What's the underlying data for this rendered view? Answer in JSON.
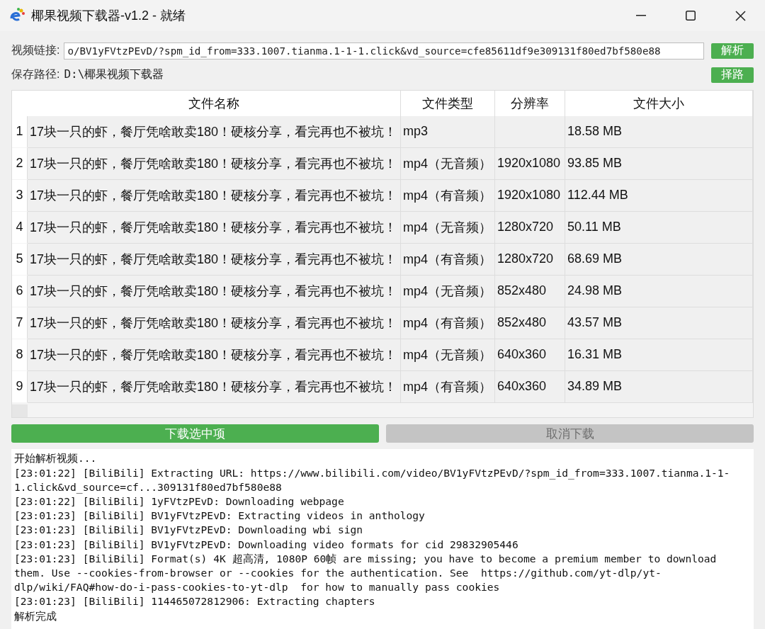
{
  "window": {
    "title": "椰果视频下载器-v1.2 - 就绪"
  },
  "url_field": {
    "label": "视频链接:",
    "value": "o/BV1yFVtzPEvD/?spm_id_from=333.1007.tianma.1-1-1.click&vd_source=cfe85611df9e309131f80ed7bf580e88",
    "button": "解析"
  },
  "save_path": {
    "label": "保存路径:",
    "value": "D:\\椰果视频下载器",
    "button": "择路"
  },
  "table": {
    "columns": [
      "文件名称",
      "文件类型",
      "分辨率",
      "文件大小"
    ],
    "rows": [
      {
        "index": "1",
        "cells": [
          "17块一只的虾，餐厅凭啥敢卖180！硬核分享，看完再也不被坑！",
          "mp3",
          "",
          "18.58 MB"
        ],
        "selected": false
      },
      {
        "index": "2",
        "cells": [
          "17块一只的虾，餐厅凭啥敢卖180！硬核分享，看完再也不被坑！",
          "mp4（无音频）",
          "1920x1080",
          "93.85 MB"
        ],
        "selected": false
      },
      {
        "index": "3",
        "cells": [
          "17块一只的虾，餐厅凭啥敢卖180！硬核分享，看完再也不被坑！",
          "mp4（有音频）",
          "1920x1080",
          "112.44 MB"
        ],
        "selected": false
      },
      {
        "index": "4",
        "cells": [
          "17块一只的虾，餐厅凭啥敢卖180！硬核分享，看完再也不被坑！",
          "mp4（无音频）",
          "1280x720",
          "50.11 MB"
        ],
        "selected": false
      },
      {
        "index": "5",
        "cells": [
          "17块一只的虾，餐厅凭啥敢卖180！硬核分享，看完再也不被坑！",
          "mp4（有音频）",
          "1280x720",
          "68.69 MB"
        ],
        "selected": false
      },
      {
        "index": "6",
        "cells": [
          "17块一只的虾，餐厅凭啥敢卖180！硬核分享，看完再也不被坑！",
          "mp4（无音频）",
          "852x480",
          "24.98 MB"
        ],
        "selected": false
      },
      {
        "index": "7",
        "cells": [
          "17块一只的虾，餐厅凭啥敢卖180！硬核分享，看完再也不被坑！",
          "mp4（有音频）",
          "852x480",
          "43.57 MB"
        ],
        "selected": false
      },
      {
        "index": "8",
        "cells": [
          "17块一只的虾，餐厅凭啥敢卖180！硬核分享，看完再也不被坑！",
          "mp4（无音频）",
          "640x360",
          "16.31 MB"
        ],
        "selected": false
      },
      {
        "index": "9",
        "cells": [
          "17块一只的虾，餐厅凭啥敢卖180！硬核分享，看完再也不被坑！",
          "mp4（有音频）",
          "640x360",
          "34.89 MB"
        ],
        "selected": false
      }
    ]
  },
  "actions": [
    {
      "label": "下载选中项",
      "disabled": false
    },
    {
      "label": "取消下载",
      "disabled": true
    }
  ],
  "log": [
    "开始解析视频...",
    "[23:01:22] [BiliBili] Extracting URL: https://www.bilibili.com/video/BV1yFVtzPEvD/?spm_id_from=333.1007.tianma.1-1-1.click&vd_source=cf...309131f80ed7bf580e88",
    "[23:01:22] [BiliBili] 1yFVtzPEvD: Downloading webpage",
    "[23:01:23] [BiliBili] BV1yFVtzPEvD: Extracting videos in anthology",
    "[23:01:23] [BiliBili] BV1yFVtzPEvD: Downloading wbi sign",
    "[23:01:23] [BiliBili] BV1yFVtzPEvD: Downloading video formats for cid 29832905446",
    "[23:01:23] [BiliBili] Format(s) 4K 超高清, 1080P 60帧 are missing; you have to become a premium member to download them. Use --cookies-from-browser or --cookies for the authentication. See  https://github.com/yt-dlp/yt-dlp/wiki/FAQ#how-do-i-pass-cookies-to-yt-dlp  for how to manually pass cookies",
    "[23:01:23] [BiliBili] 114465072812906: Extracting chapters",
    "解析完成"
  ]
}
